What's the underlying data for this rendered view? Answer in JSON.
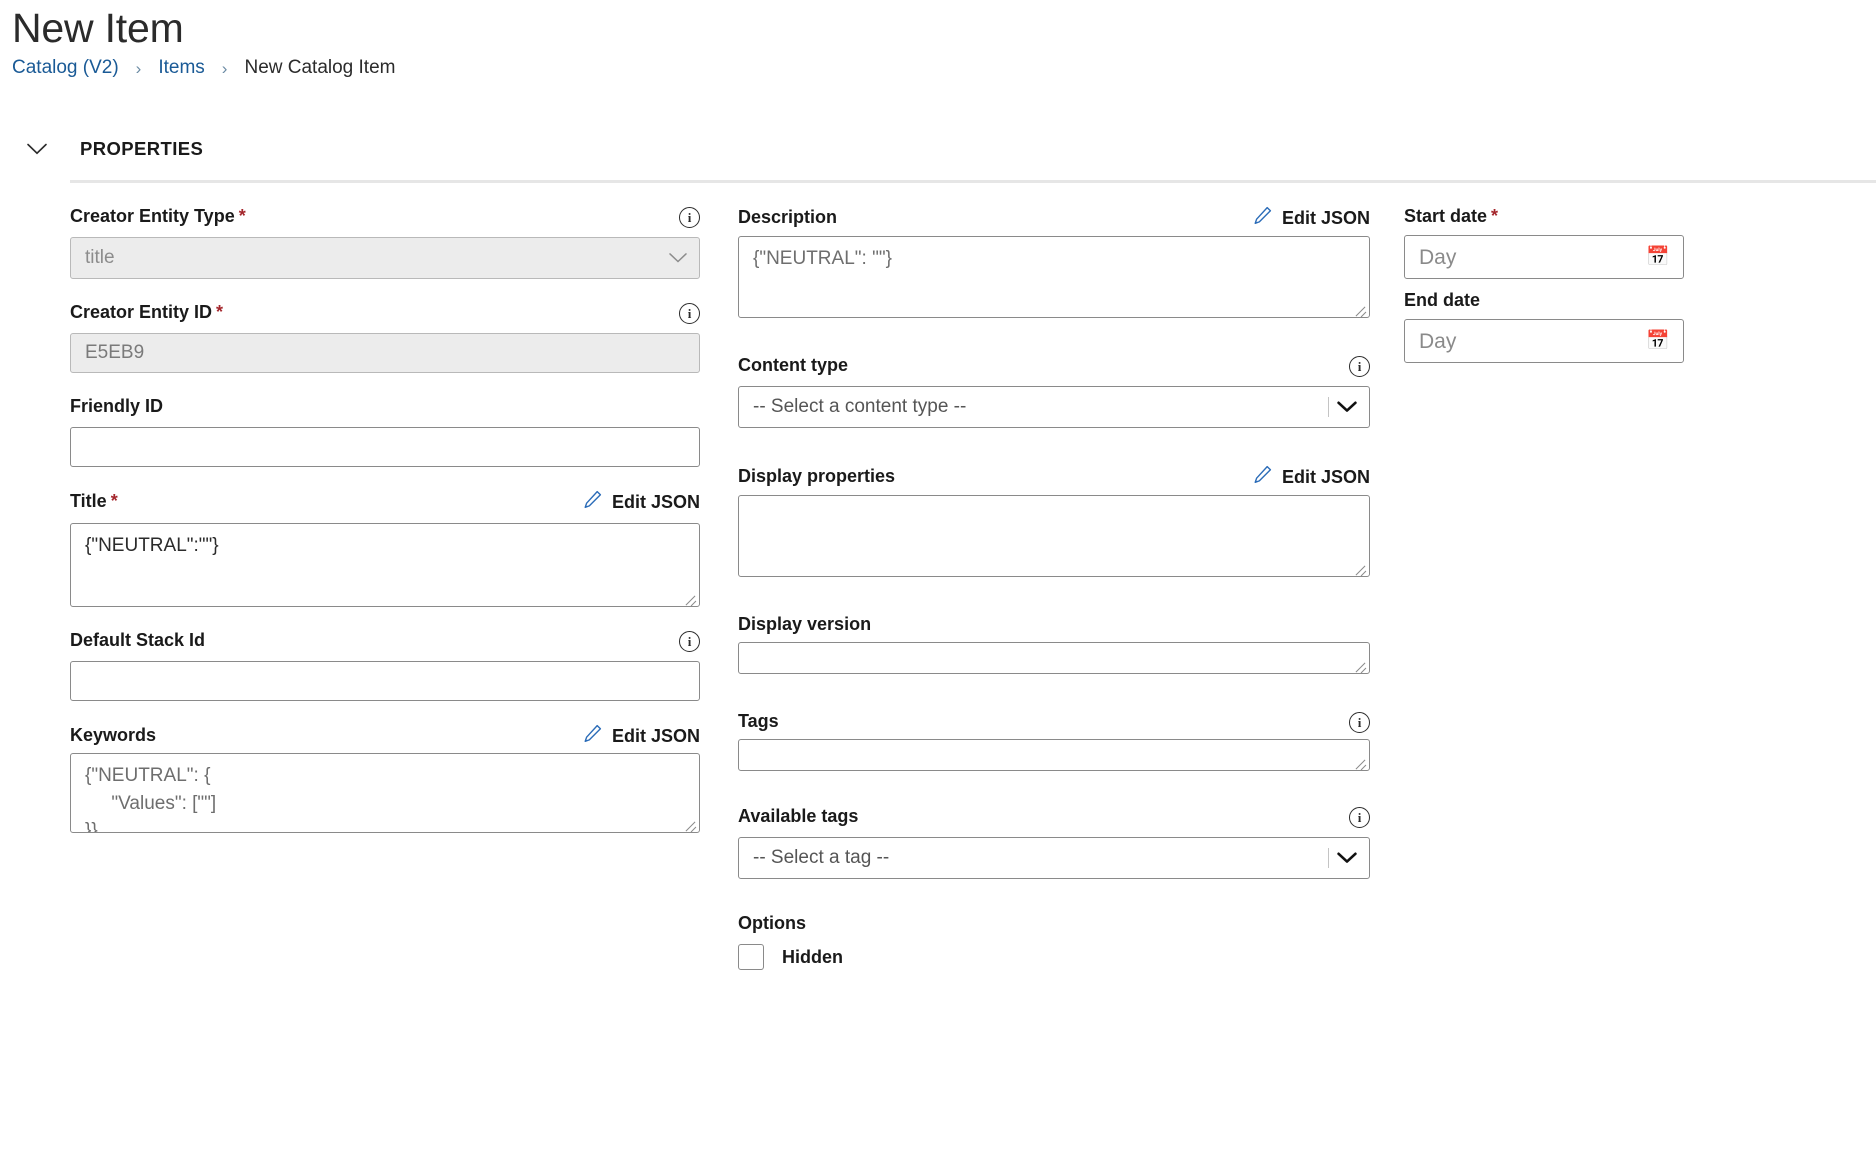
{
  "header": {
    "title": "New Item",
    "breadcrumb": [
      {
        "label": "Catalog (V2)",
        "type": "link"
      },
      {
        "label": "Items",
        "type": "link"
      },
      {
        "label": "New Catalog Item",
        "type": "current"
      }
    ],
    "separator": "›"
  },
  "section": {
    "label": "PROPERTIES",
    "collapse_icon": "chevron-down-icon"
  },
  "common": {
    "edit_json_label": "Edit JSON",
    "info_glyph": "i",
    "calendar_glyph": "📅",
    "required_marker": "*"
  },
  "column_left": {
    "creator_entity_type": {
      "label": "Creator Entity Type",
      "required": true,
      "has_info": true,
      "value": "title",
      "disabled": true,
      "control": "select"
    },
    "creator_entity_id": {
      "label": "Creator Entity ID",
      "required": true,
      "has_info": true,
      "value": "E5EB9",
      "disabled": true,
      "control": "text"
    },
    "friendly_id": {
      "label": "Friendly ID",
      "required": false,
      "has_info": false,
      "value": "",
      "control": "text"
    },
    "title": {
      "label": "Title",
      "required": true,
      "has_edit_json": true,
      "value": "{\"NEUTRAL\":\"\"}",
      "control": "textarea"
    },
    "default_stack_id": {
      "label": "Default Stack Id",
      "required": false,
      "has_info": true,
      "value": "",
      "control": "text"
    },
    "keywords": {
      "label": "Keywords",
      "required": false,
      "has_edit_json": true,
      "value": "{\"NEUTRAL\": {\n     \"Values\": [\"\"]\n}}",
      "control": "textarea"
    }
  },
  "column_middle": {
    "description": {
      "label": "Description",
      "required": false,
      "has_edit_json": true,
      "value": "{\"NEUTRAL\": \"\"}",
      "control": "textarea"
    },
    "content_type": {
      "label": "Content type",
      "required": false,
      "has_info": true,
      "value": "-- Select a content type --",
      "control": "select"
    },
    "display_properties": {
      "label": "Display properties",
      "required": false,
      "has_edit_json": true,
      "value": "",
      "control": "textarea"
    },
    "display_version": {
      "label": "Display version",
      "required": false,
      "has_info": false,
      "value": "",
      "control": "textarea"
    },
    "tags": {
      "label": "Tags",
      "required": false,
      "has_info": true,
      "value": "",
      "control": "textarea"
    },
    "available_tags": {
      "label": "Available tags",
      "required": false,
      "has_info": true,
      "value": "-- Select a tag --",
      "control": "select"
    },
    "options": {
      "label": "Options",
      "items": [
        {
          "label": "Hidden",
          "checked": false
        }
      ]
    }
  },
  "column_right": {
    "start_date": {
      "label": "Start date",
      "required": true,
      "placeholder": "Day",
      "value": ""
    },
    "end_date": {
      "label": "End date",
      "required": false,
      "placeholder": "Day",
      "value": ""
    }
  },
  "colors": {
    "link": "#1a5a96",
    "required": "#a4262c",
    "accent_pencil": "#2b6cb8",
    "border": "#8a8a8a",
    "disabled_bg": "#ececec"
  }
}
